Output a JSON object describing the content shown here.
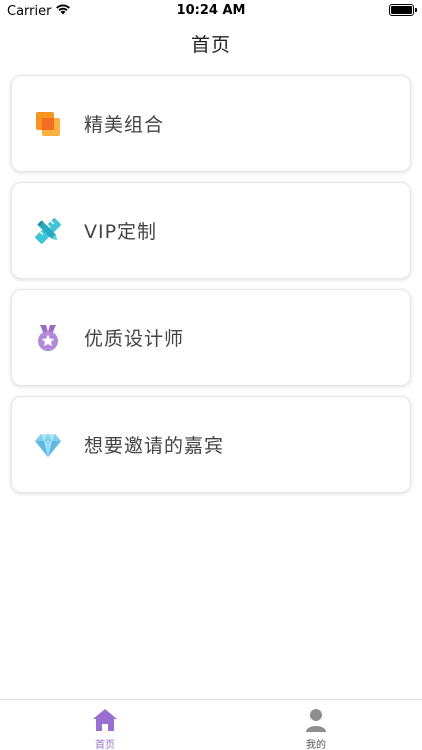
{
  "status_bar": {
    "carrier": "Carrier",
    "time": "10:24 AM"
  },
  "nav": {
    "title": "首页"
  },
  "menu": [
    {
      "label": "精美组合",
      "icon": "stacked-squares-icon"
    },
    {
      "label": "VIP定制",
      "icon": "pencil-ruler-icon"
    },
    {
      "label": "优质设计师",
      "icon": "medal-icon"
    },
    {
      "label": "想要邀请的嘉宾",
      "icon": "diamond-icon"
    }
  ],
  "tab_bar": {
    "home_label": "首页",
    "mine_label": "我的",
    "active_color": "#9b6fd0",
    "inactive_color": "#8e8e8e"
  },
  "colors": {
    "orange": "#f7941d",
    "cyan": "#3ec6d6",
    "purple": "#b38ad8",
    "sky": "#7ecff0"
  }
}
